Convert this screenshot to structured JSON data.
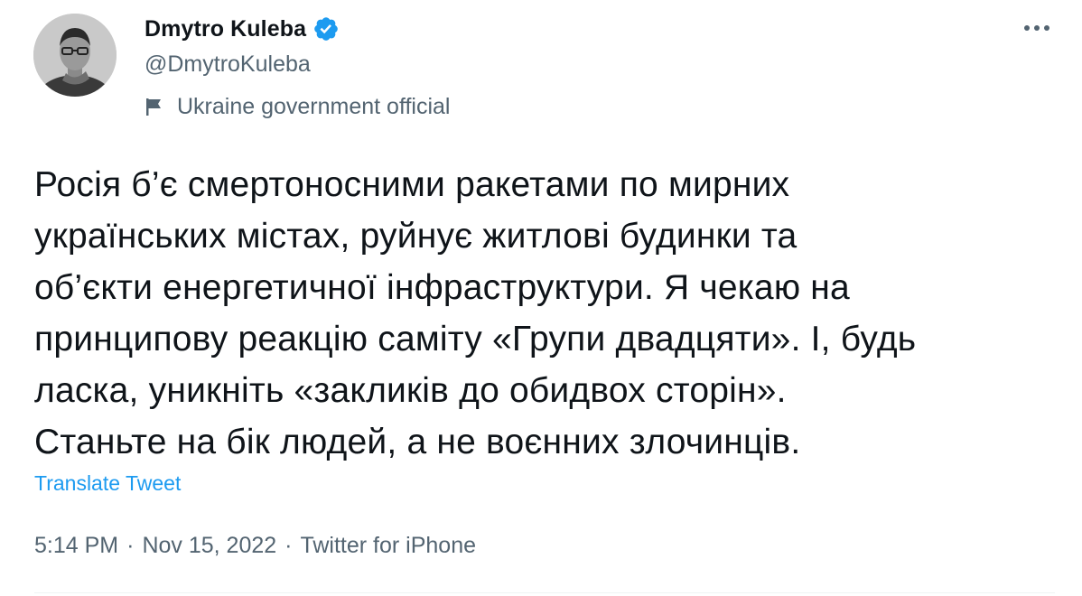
{
  "author": {
    "display_name": "Dmytro Kuleba",
    "handle": "@DmytroKuleba",
    "label": "Ukraine government official",
    "verified_color": "#1d9bf0"
  },
  "tweet": {
    "text": "Росія б’є смертоносними ракетами по мирних\nукраїнських містах, руйнує житлові будинки та\nоб’єкти енергетичної інфраструктури. Я чекаю на\nпринципову реакцію саміту «Групи двадцяти». І, будь\nласка, уникніть «закликів до обидвох сторін».\nСтаньте на бік людей, а не воєнних злочинців.",
    "translate_label": "Translate Tweet"
  },
  "meta": {
    "time": "5:14 PM",
    "separator": "·",
    "date": "Nov 15, 2022",
    "source": "Twitter for iPhone"
  },
  "icons": {
    "more": "more-horizontal-icon",
    "verified": "verified-badge-icon",
    "label": "flag-icon"
  },
  "colors": {
    "text_primary": "#0f1419",
    "text_secondary": "#536471",
    "link": "#1d9bf0"
  }
}
